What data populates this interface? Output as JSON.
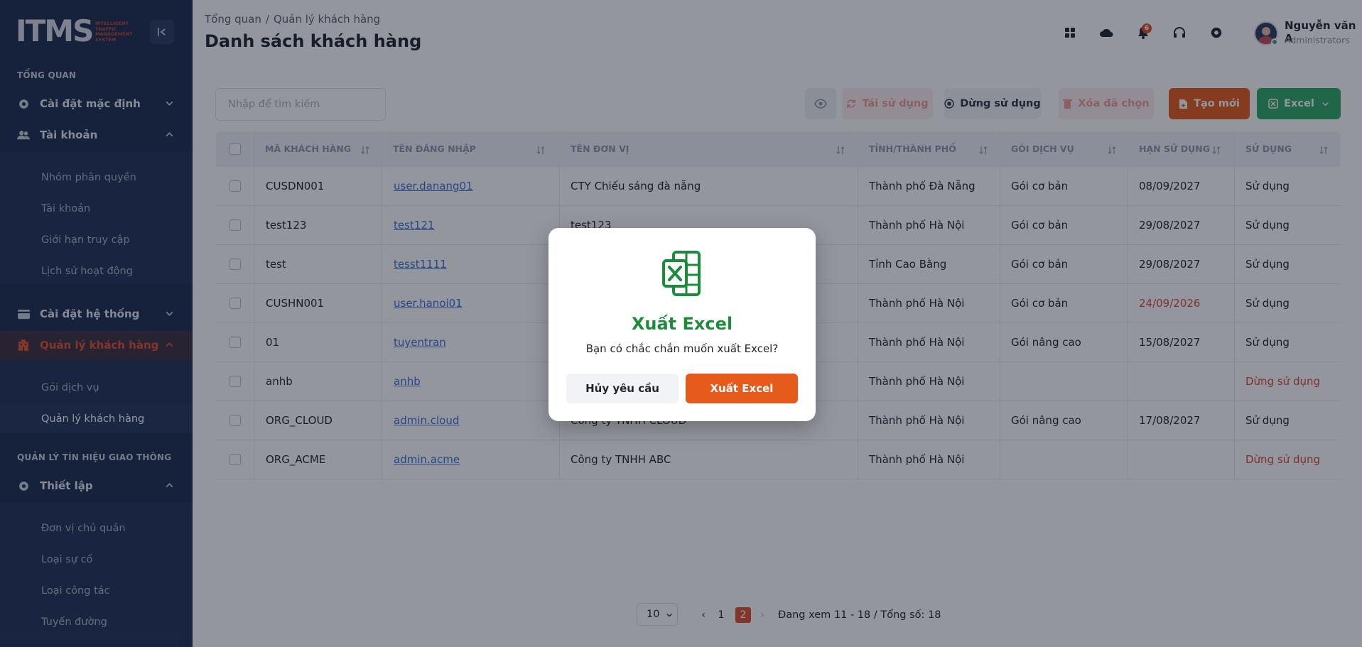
{
  "brand": {
    "mark_a": "IT",
    "mark_b": "MS",
    "subtitle": "INTELLIGENT TRAFFIC MANAGEMENT SYSTEM"
  },
  "sidebar": {
    "section_overview": "TỔNG QUAN",
    "default_settings": "Cài đặt mặc định",
    "accounts": "Tài khoản",
    "accounts_children": [
      "Nhóm phân quyền",
      "Tài khoản",
      "Giới hạn truy cập",
      "Lịch sử hoạt động"
    ],
    "system_settings": "Cài đặt hệ thống",
    "customer_mgmt": "Quản lý khách hàng",
    "customer_children": [
      "Gói dịch vụ",
      "Quản lý khách hàng"
    ],
    "section_traffic": "QUẢN LÝ TÍN HIỆU GIAO THÔNG",
    "setup": "Thiết lập",
    "setup_children": [
      "Đơn vị chủ quản",
      "Loại sự cố",
      "Loại công tác",
      "Tuyến đường"
    ]
  },
  "header": {
    "breadcrumb": [
      "Tổng quan",
      "Quản lý khách hàng"
    ],
    "breadcrumb_sep": "/",
    "title": "Danh sách khách hàng",
    "notification_count": "6",
    "user_name": "Nguyễn văn A",
    "user_role": "Administrators"
  },
  "toolbar": {
    "search_placeholder": "Nhập để tìm kiếm",
    "reuse": "Tái sử dụng",
    "stop_use": "Dừng sử dụng",
    "delete_selected": "Xóa đã chọn",
    "create": "Tạo mới",
    "excel": "Excel"
  },
  "table": {
    "columns": [
      "MÃ KHÁCH HÀNG",
      "TÊN ĐĂNG NHẬP",
      "TÊN ĐƠN VỊ",
      "TỈNH/THÀNH PHỐ",
      "GÓI DỊCH VỤ",
      "HẠN SỬ DỤNG",
      "SỬ DỤNG"
    ],
    "rows": [
      {
        "code": "CUSDN001",
        "login": "user.danang01",
        "unit": "CTY Chiếu sáng đà nẵng",
        "city": "Thành phố Đà Nẵng",
        "package": "Gói cơ bản",
        "expiry": "08/09/2027",
        "status": "Sử dụng"
      },
      {
        "code": "test123",
        "login": "test121",
        "unit": "test123",
        "city": "Thành phố Hà Nội",
        "package": "Gói cơ bản",
        "expiry": "29/08/2027",
        "status": "Sử dụng"
      },
      {
        "code": "test",
        "login": "tesst1111",
        "unit": "",
        "city": "Tỉnh Cao Bằng",
        "package": "Gói cơ bản",
        "expiry": "29/08/2027",
        "status": "Sử dụng"
      },
      {
        "code": "CUSHN001",
        "login": "user.hanoi01",
        "unit": "",
        "city": "Thành phố Hà Nội",
        "package": "Gói cơ bản",
        "expiry": "24/09/2026",
        "status": "Sử dụng"
      },
      {
        "code": "01",
        "login": "tuyentran",
        "unit": "",
        "city": "Thành phố Hà Nội",
        "package": "Gói nâng cao",
        "expiry": "15/08/2027",
        "status": "Sử dụng"
      },
      {
        "code": "anhb",
        "login": "anhb",
        "unit": "",
        "city": "Thành phố Hà Nội",
        "package": "",
        "expiry": "",
        "status": "Dừng sử dụng"
      },
      {
        "code": "ORG_CLOUD",
        "login": "admin.cloud",
        "unit": "Công ty TNHH CLOUD",
        "city": "Thành phố Hà Nội",
        "package": "Gói nâng cao",
        "expiry": "17/08/2027",
        "status": "Sử dụng"
      },
      {
        "code": "ORG_ACME",
        "login": "admin.acme",
        "unit": "Công ty TNHH ABC",
        "city": "Thành phố Hà Nội",
        "package": "",
        "expiry": "",
        "status": "Dừng sử dụng"
      }
    ]
  },
  "pagination": {
    "page_size": "10",
    "pages": [
      "1",
      "2"
    ],
    "current": "2",
    "info": "Đang xem 11 - 18 / Tổng số: 18"
  },
  "modal": {
    "title": "Xuất Excel",
    "message": "Bạn có chắc chắn muốn xuất Excel?",
    "cancel": "Hủy yêu cầu",
    "confirm": "Xuất Excel"
  },
  "colors": {
    "sidebar_bg": "#1c2a4e",
    "accent": "#e2502a",
    "excel_green": "#1c8c3c",
    "link": "#3d6fd8",
    "danger": "#e0443a"
  },
  "icons": [
    "gear-icon",
    "users-icon",
    "chevron-down-icon",
    "chevron-up-icon",
    "card-icon",
    "building-icon",
    "grid-icon",
    "cloud-icon",
    "bell-icon",
    "headset-icon",
    "settings-icon",
    "eye-icon",
    "refresh-icon",
    "stop-icon",
    "trash-icon",
    "file-add-icon",
    "excel-icon",
    "sort-icon"
  ]
}
